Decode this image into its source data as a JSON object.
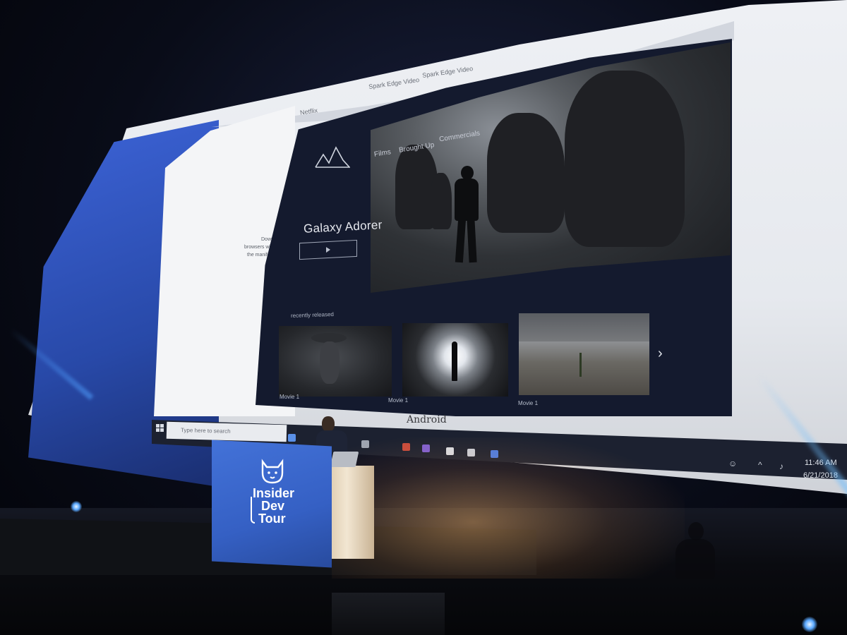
{
  "browser": {
    "tabs": [
      "Spark Edge Video",
      "Spark Edge Video",
      "Netflix"
    ]
  },
  "left_panel": {
    "lines": [
      "Download",
      "browsers will",
      "the manifest"
    ]
  },
  "app": {
    "brand_icon": "mountain-logo-icon",
    "nav": [
      "Films",
      "Brought Up",
      "Commercials"
    ],
    "hero_title": "Galaxy Adorer",
    "play_icon": "play-icon",
    "section_label": "recently released",
    "movies": [
      {
        "caption": "Movie 1"
      },
      {
        "caption": "Movie 1"
      },
      {
        "caption": "Movie 1"
      }
    ],
    "next_icon": "chevron-right-icon"
  },
  "caption": "Android",
  "taskbar": {
    "search_placeholder": "Type here to search",
    "time": "11:46 AM",
    "date": "6/21/2018"
  },
  "podium": {
    "line1": "Insider",
    "line2": "Dev",
    "line3": "Tour"
  }
}
